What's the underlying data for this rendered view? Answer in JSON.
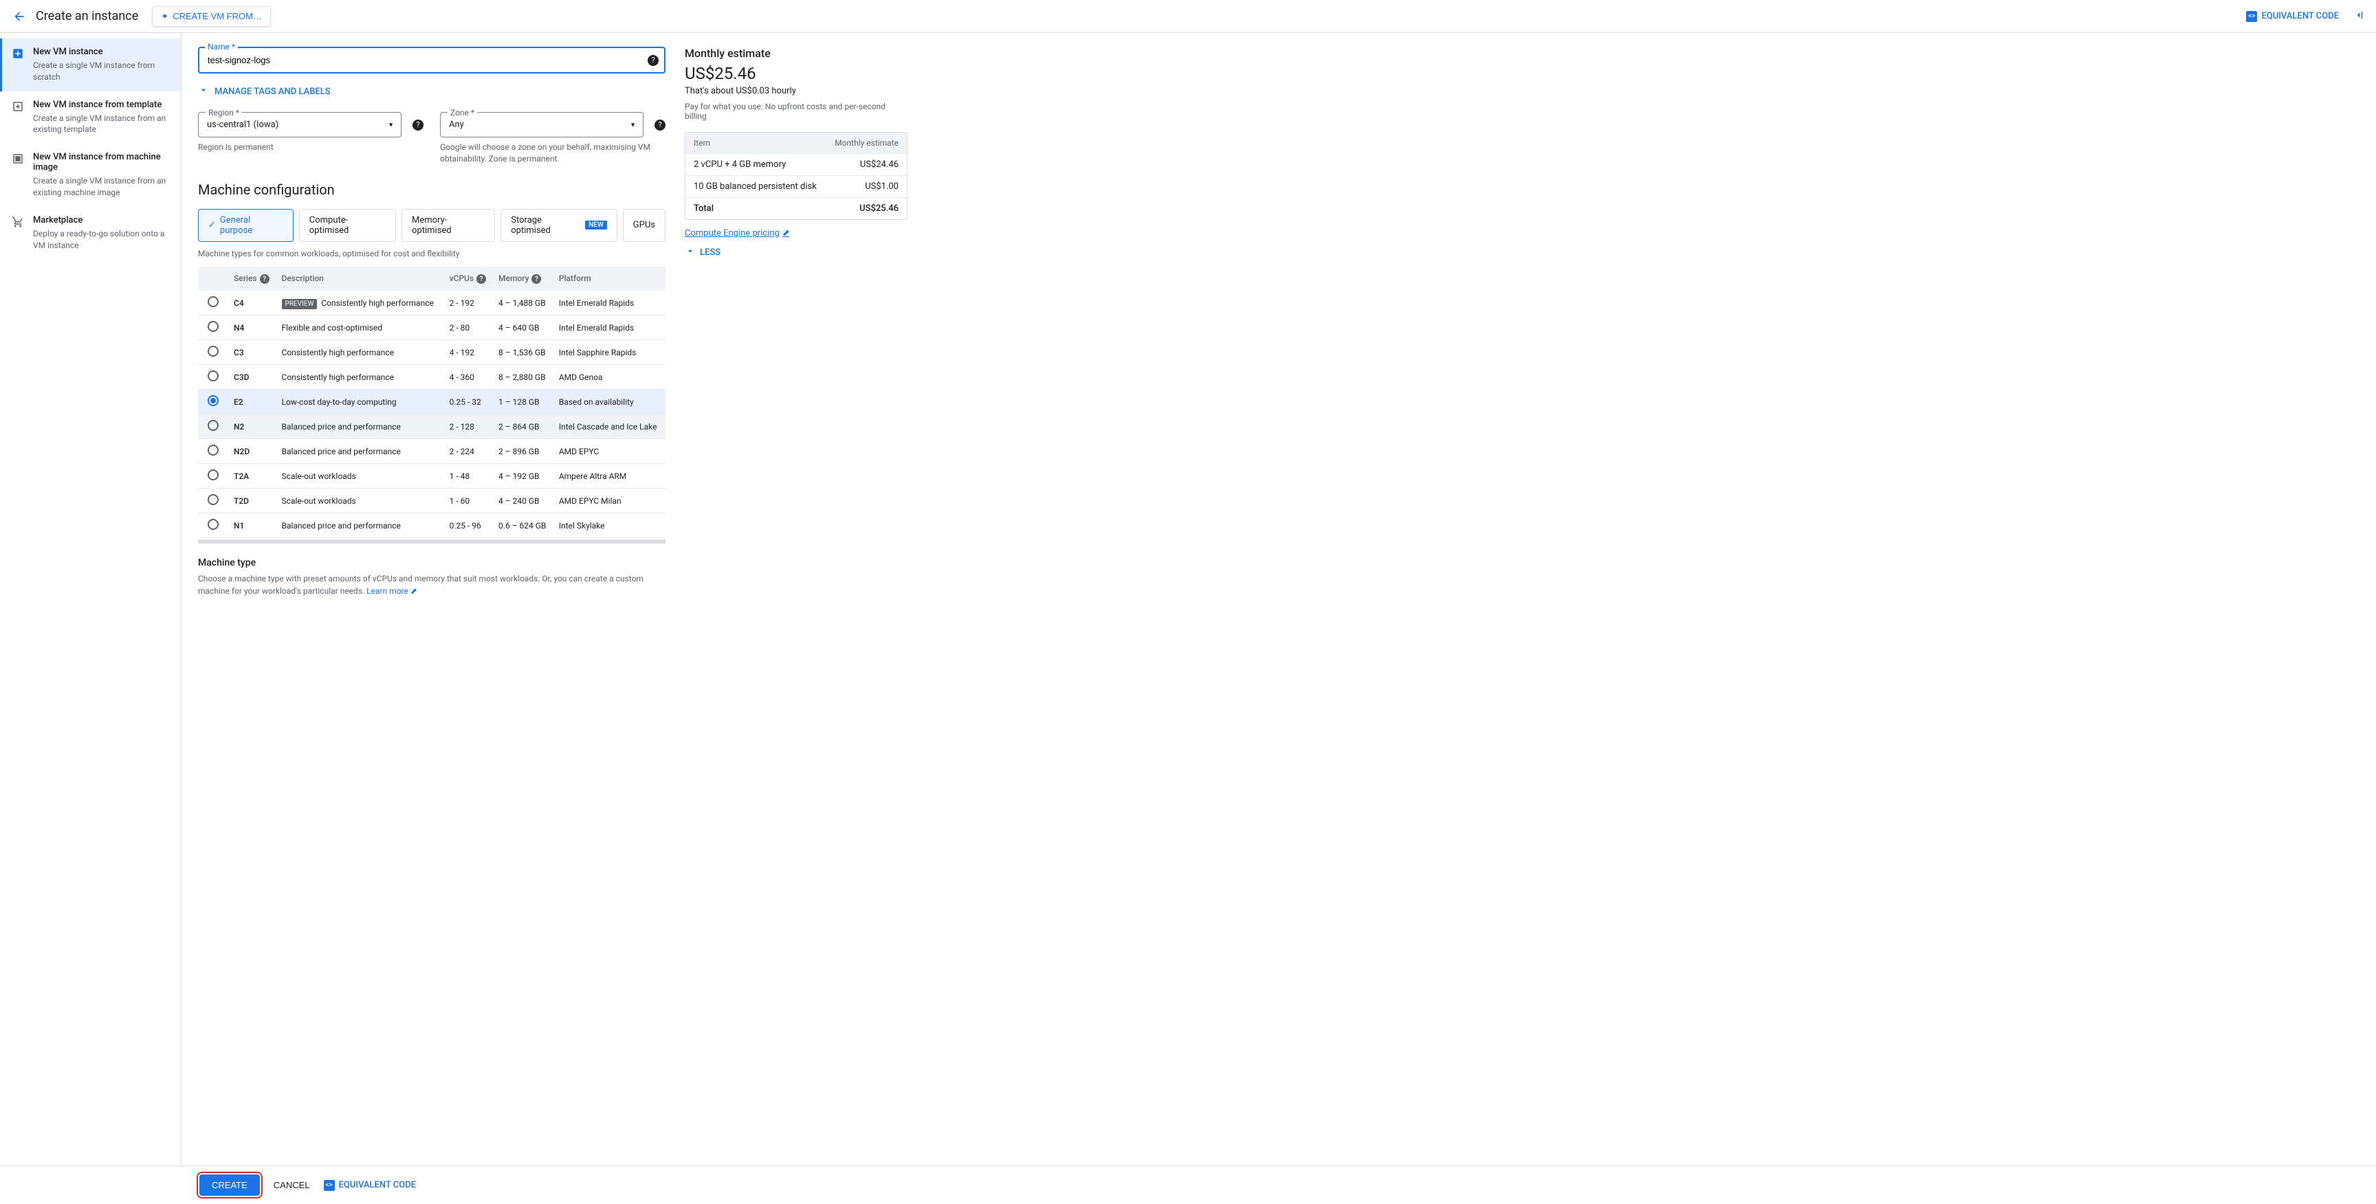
{
  "topbar": {
    "title": "Create an instance",
    "create_from_label": "CREATE VM FROM…",
    "equivalent_code": "EQUIVALENT CODE"
  },
  "leftnav": {
    "items": [
      {
        "title": "New VM instance",
        "desc": "Create a single VM instance from scratch",
        "selected": true,
        "icon": "plus-box"
      },
      {
        "title": "New VM instance from template",
        "desc": "Create a single VM instance from an existing template",
        "selected": false,
        "icon": "plus-box-outline"
      },
      {
        "title": "New VM instance from machine image",
        "desc": "Create a single VM instance from an existing machine image",
        "selected": false,
        "icon": "image-box"
      },
      {
        "title": "Marketplace",
        "desc": "Deploy a ready-to-go solution onto a VM instance",
        "selected": false,
        "icon": "cart"
      }
    ]
  },
  "form": {
    "name_label": "Name *",
    "name_value": "test-signoz-logs",
    "manage_tags": "MANAGE TAGS AND LABELS",
    "region_label": "Region *",
    "region_value": "us-central1 (Iowa)",
    "region_hint": "Region is permanent",
    "zone_label": "Zone *",
    "zone_value": "Any",
    "zone_hint": "Google will choose a zone on your behalf, maximising VM obtainability. Zone is permanent.",
    "machine_config_heading": "Machine configuration",
    "tabs": [
      {
        "label": "General purpose",
        "active": true,
        "check": true
      },
      {
        "label": "Compute-optimised",
        "active": false
      },
      {
        "label": "Memory-optimised",
        "active": false
      },
      {
        "label": "Storage optimised",
        "active": false,
        "badge": "NEW"
      },
      {
        "label": "GPUs",
        "active": false
      }
    ],
    "tab_description": "Machine types for common workloads, optimised for cost and flexibility",
    "table_headers": {
      "series": "Series",
      "description": "Description",
      "vcpus": "vCPUs",
      "memory": "Memory",
      "platform": "Platform"
    },
    "series": [
      {
        "name": "C4",
        "desc": "Consistently high performance",
        "vcpus": "2 - 192",
        "memory": "4 – 1,488 GB",
        "platform": "Intel Emerald Rapids",
        "preview": true,
        "selected": false
      },
      {
        "name": "N4",
        "desc": "Flexible and cost-optimised",
        "vcpus": "2 - 80",
        "memory": "4 – 640 GB",
        "platform": "Intel Emerald Rapids",
        "selected": false
      },
      {
        "name": "C3",
        "desc": "Consistently high performance",
        "vcpus": "4 - 192",
        "memory": "8 – 1,536 GB",
        "platform": "Intel Sapphire Rapids",
        "selected": false
      },
      {
        "name": "C3D",
        "desc": "Consistently high performance",
        "vcpus": "4 - 360",
        "memory": "8 – 2,880 GB",
        "platform": "AMD Genoa",
        "selected": false
      },
      {
        "name": "E2",
        "desc": "Low-cost day-to-day computing",
        "vcpus": "0.25 - 32",
        "memory": "1 – 128 GB",
        "platform": "Based on availability",
        "selected": true
      },
      {
        "name": "N2",
        "desc": "Balanced price and performance",
        "vcpus": "2 - 128",
        "memory": "2 – 864 GB",
        "platform": "Intel Cascade and Ice Lake",
        "selected": false,
        "hover": true
      },
      {
        "name": "N2D",
        "desc": "Balanced price and performance",
        "vcpus": "2 - 224",
        "memory": "2 – 896 GB",
        "platform": "AMD EPYC",
        "selected": false
      },
      {
        "name": "T2A",
        "desc": "Scale-out workloads",
        "vcpus": "1 - 48",
        "memory": "4 – 192 GB",
        "platform": "Ampere Altra ARM",
        "selected": false
      },
      {
        "name": "T2D",
        "desc": "Scale-out workloads",
        "vcpus": "1 - 60",
        "memory": "4 – 240 GB",
        "platform": "AMD EPYC Milan",
        "selected": false
      },
      {
        "name": "N1",
        "desc": "Balanced price and performance",
        "vcpus": "0.25 - 96",
        "memory": "0.6 – 624 GB",
        "platform": "Intel Skylake",
        "selected": false
      }
    ],
    "machine_type_title": "Machine type",
    "machine_type_desc": "Choose a machine type with preset amounts of vCPUs and memory that suit most workloads. Or, you can create a custom machine for your workload's particular needs. ",
    "learn_more": "Learn more"
  },
  "estimate": {
    "heading": "Monthly estimate",
    "price": "US$25.46",
    "hourly": "That's about US$0.03 hourly",
    "note": "Pay for what you use: No upfront costs and per-second billing",
    "table_header_item": "Item",
    "table_header_estimate": "Monthly estimate",
    "rows": [
      {
        "item": "2 vCPU + 4 GB memory",
        "cost": "US$24.46"
      },
      {
        "item": "10 GB balanced persistent disk",
        "cost": "US$1.00"
      },
      {
        "item": "Total",
        "cost": "US$25.46",
        "total": true
      }
    ],
    "pricing_link": "Compute Engine pricing",
    "less_label": "LESS"
  },
  "footer": {
    "create": "CREATE",
    "cancel": "CANCEL",
    "equivalent_code": "EQUIVALENT CODE"
  }
}
